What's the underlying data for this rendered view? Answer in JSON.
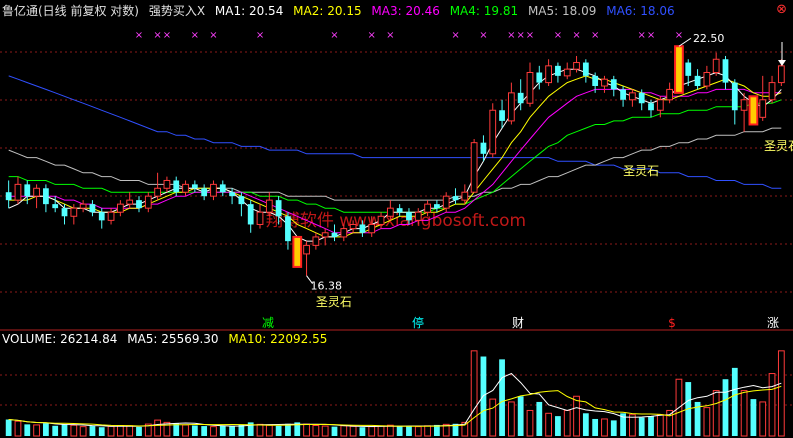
{
  "header": {
    "title": "鲁亿通(日线 前复权 对数)",
    "indicator": "强势买入X",
    "ma": [
      {
        "label": "MA1:",
        "value": "20.54",
        "color": "#ffffff"
      },
      {
        "label": "MA2:",
        "value": "20.15",
        "color": "#ffff00"
      },
      {
        "label": "MA3:",
        "value": "20.46",
        "color": "#ff00ff"
      },
      {
        "label": "MA4:",
        "value": "19.81",
        "color": "#00ff00"
      },
      {
        "label": "MA5:",
        "value": "18.09",
        "color": "#c0c0c0"
      },
      {
        "label": "MA6:",
        "value": "18.06",
        "color": "#3050ff"
      }
    ]
  },
  "volume_header": {
    "items": [
      {
        "label": "VOLUME:",
        "value": "26214.84",
        "color": "#ffffff"
      },
      {
        "label": "MA5:",
        "value": "25569.30",
        "color": "#ffffff"
      },
      {
        "label": "MA10:",
        "value": "22092.55",
        "color": "#ffff00"
      }
    ]
  },
  "watermark": "翔博软件 www.xiangbosoft.com",
  "annotations": {
    "high": "22.50",
    "low": "16.38",
    "stone1": "圣灵石",
    "stone2": "圣灵石",
    "stone3": "圣灵石"
  },
  "signals": [
    {
      "label": "减",
      "color": "#00ff00"
    },
    {
      "label": "停",
      "color": "#00ffff"
    },
    {
      "label": "财",
      "color": "#ffffff"
    },
    {
      "label": "$",
      "color": "#ff2020"
    },
    {
      "label": "涨",
      "color": "#ffffff"
    }
  ],
  "colors": {
    "up": "#ff3a3a",
    "down": "#54ffff",
    "grid": "#8b1a1a",
    "marker": "#ff40ff"
  },
  "chart_data": {
    "type": "candlestick",
    "ylim": [
      15.6,
      23.2
    ],
    "candles": [
      [
        18.4,
        18.2,
        18.7,
        18.0
      ],
      [
        18.2,
        18.6,
        18.8,
        18.1
      ],
      [
        18.6,
        18.3,
        18.7,
        18.1
      ],
      [
        18.3,
        18.5,
        18.6,
        18.0
      ],
      [
        18.5,
        18.1,
        18.6,
        17.9
      ],
      [
        18.1,
        18.0,
        18.3,
        17.9
      ],
      [
        18.0,
        17.8,
        18.1,
        17.6
      ],
      [
        17.8,
        18.0,
        18.1,
        17.6
      ],
      [
        18.0,
        18.1,
        18.2,
        17.9
      ],
      [
        18.1,
        17.9,
        18.2,
        17.8
      ],
      [
        17.9,
        17.7,
        18.0,
        17.5
      ],
      [
        17.7,
        17.9,
        18.0,
        17.6
      ],
      [
        17.9,
        18.1,
        18.2,
        17.8
      ],
      [
        18.1,
        18.2,
        18.4,
        18.0
      ],
      [
        18.2,
        18.0,
        18.3,
        17.9
      ],
      [
        18.0,
        18.3,
        18.4,
        17.9
      ],
      [
        18.3,
        18.5,
        18.9,
        18.2
      ],
      [
        18.5,
        18.7,
        18.8,
        18.4
      ],
      [
        18.7,
        18.4,
        18.8,
        18.3
      ],
      [
        18.4,
        18.6,
        18.7,
        18.3
      ],
      [
        18.6,
        18.5,
        18.7,
        18.4
      ],
      [
        18.5,
        18.3,
        18.6,
        18.2
      ],
      [
        18.3,
        18.6,
        18.7,
        18.2
      ],
      [
        18.6,
        18.4,
        18.7,
        18.3
      ],
      [
        18.4,
        18.3,
        18.5,
        18.1
      ],
      [
        18.3,
        18.1,
        18.4,
        17.8
      ],
      [
        18.1,
        17.6,
        18.2,
        17.4
      ],
      [
        17.6,
        17.9,
        18.1,
        17.5
      ],
      [
        17.9,
        18.2,
        18.4,
        17.8
      ],
      [
        18.2,
        17.8,
        18.3,
        17.6
      ],
      [
        17.8,
        17.2,
        17.9,
        17.0
      ],
      [
        17.2,
        16.9,
        17.3,
        16.6
      ],
      [
        16.9,
        17.1,
        17.2,
        16.4
      ],
      [
        17.1,
        17.3,
        17.4,
        17.0
      ],
      [
        17.3,
        17.4,
        17.5,
        17.1
      ],
      [
        17.4,
        17.3,
        17.6,
        17.2
      ],
      [
        17.3,
        17.5,
        17.6,
        17.2
      ],
      [
        17.5,
        17.6,
        17.7,
        17.4
      ],
      [
        17.6,
        17.4,
        17.7,
        17.3
      ],
      [
        17.4,
        17.6,
        17.8,
        17.3
      ],
      [
        17.6,
        17.8,
        17.9,
        17.5
      ],
      [
        17.8,
        18.0,
        18.2,
        17.7
      ],
      [
        18.0,
        17.9,
        18.1,
        17.8
      ],
      [
        17.9,
        17.7,
        18.0,
        17.6
      ],
      [
        17.7,
        17.9,
        18.0,
        17.6
      ],
      [
        17.9,
        18.1,
        18.2,
        17.8
      ],
      [
        18.1,
        18.0,
        18.2,
        17.9
      ],
      [
        18.0,
        18.3,
        18.4,
        17.9
      ],
      [
        18.3,
        18.2,
        18.5,
        18.1
      ],
      [
        18.2,
        18.4,
        18.6,
        18.1
      ],
      [
        18.4,
        19.7,
        19.8,
        18.4
      ],
      [
        19.7,
        19.4,
        19.9,
        19.2
      ],
      [
        19.4,
        20.6,
        20.8,
        19.3
      ],
      [
        20.6,
        20.3,
        20.9,
        20.1
      ],
      [
        20.3,
        21.1,
        21.4,
        20.2
      ],
      [
        21.1,
        20.8,
        21.5,
        20.6
      ],
      [
        20.8,
        21.7,
        22.0,
        20.7
      ],
      [
        21.7,
        21.4,
        21.9,
        21.2
      ],
      [
        21.4,
        21.9,
        22.1,
        21.3
      ],
      [
        21.9,
        21.6,
        22.0,
        21.4
      ],
      [
        21.6,
        21.8,
        22.0,
        21.5
      ],
      [
        21.8,
        22.0,
        22.2,
        21.7
      ],
      [
        22.0,
        21.6,
        22.1,
        21.4
      ],
      [
        21.6,
        21.3,
        21.7,
        21.1
      ],
      [
        21.3,
        21.5,
        21.6,
        21.1
      ],
      [
        21.5,
        21.2,
        21.6,
        21.0
      ],
      [
        21.2,
        20.9,
        21.3,
        20.7
      ],
      [
        20.9,
        21.1,
        21.2,
        20.7
      ],
      [
        21.1,
        20.8,
        21.2,
        20.6
      ],
      [
        20.8,
        20.6,
        20.9,
        20.4
      ],
      [
        20.6,
        20.9,
        21.0,
        20.4
      ],
      [
        20.9,
        21.2,
        21.4,
        20.8
      ],
      [
        21.2,
        22.0,
        22.5,
        21.1
      ],
      [
        22.0,
        21.6,
        22.1,
        21.3
      ],
      [
        21.6,
        21.3,
        21.8,
        21.2
      ],
      [
        21.3,
        21.7,
        21.9,
        21.2
      ],
      [
        21.7,
        22.1,
        22.3,
        21.6
      ],
      [
        22.1,
        21.4,
        22.2,
        21.2
      ],
      [
        21.4,
        20.6,
        21.5,
        20.2
      ],
      [
        20.6,
        20.9,
        21.1,
        20.0
      ],
      [
        20.9,
        20.4,
        21.0,
        20.2
      ],
      [
        20.4,
        20.9,
        21.6,
        20.3
      ],
      [
        20.9,
        21.4,
        21.6,
        20.8
      ],
      [
        21.4,
        21.9,
        22.1,
        21.3
      ]
    ],
    "volumes": [
      5800,
      5200,
      4100,
      3900,
      4500,
      3600,
      4200,
      3800,
      3300,
      3500,
      3100,
      3400,
      3700,
      3600,
      3200,
      4200,
      5600,
      4800,
      4400,
      3900,
      3700,
      3500,
      3300,
      3600,
      3400,
      3900,
      4800,
      4100,
      3800,
      3600,
      4300,
      4800,
      4200,
      3700,
      3500,
      3300,
      3600,
      3400,
      3100,
      3300,
      3500,
      3800,
      3600,
      3400,
      3300,
      3600,
      3900,
      4100,
      4300,
      4800,
      30000,
      28000,
      13000,
      27000,
      12000,
      14000,
      9000,
      12000,
      8000,
      7000,
      9000,
      14000,
      8000,
      6000,
      6000,
      5500,
      8000,
      7500,
      6500,
      7000,
      7500,
      9000,
      20000,
      19000,
      12000,
      10000,
      16000,
      20000,
      24000,
      16000,
      13000,
      12000,
      22000,
      30000
    ],
    "ma1": [
      18.0,
      18.1,
      18.3,
      18.3,
      18.3,
      18.2,
      18.0,
      18.0,
      18.0,
      17.9,
      17.9,
      17.9,
      18.0,
      18.1,
      18.1,
      18.2,
      18.3,
      18.4,
      18.5,
      18.5,
      18.5,
      18.4,
      18.5,
      18.5,
      18.4,
      18.2,
      18.0,
      17.9,
      17.9,
      17.8,
      17.6,
      17.3,
      17.2,
      17.2,
      17.3,
      17.3,
      17.4,
      17.5,
      17.5,
      17.6,
      17.7,
      17.9,
      17.9,
      17.9,
      17.9,
      18.0,
      18.0,
      18.1,
      18.2,
      18.3,
      18.8,
      19.2,
      19.7,
      20.1,
      20.5,
      20.8,
      21.1,
      21.4,
      21.6,
      21.7,
      21.8,
      21.8,
      21.7,
      21.6,
      21.4,
      21.3,
      21.1,
      21.0,
      20.9,
      20.8,
      20.9,
      21.0,
      21.3,
      21.4,
      21.5,
      21.6,
      21.7,
      21.6,
      21.3,
      21.0,
      20.8,
      20.7,
      20.9,
      21.2
    ],
    "ma2": [
      18.2,
      18.2,
      18.2,
      18.3,
      18.3,
      18.2,
      18.1,
      18.0,
      18.0,
      18.0,
      17.9,
      17.9,
      17.9,
      18.0,
      18.0,
      18.1,
      18.2,
      18.3,
      18.4,
      18.4,
      18.5,
      18.5,
      18.5,
      18.5,
      18.4,
      18.3,
      18.2,
      18.1,
      18.0,
      17.9,
      17.8,
      17.6,
      17.5,
      17.4,
      17.3,
      17.3,
      17.3,
      17.4,
      17.4,
      17.5,
      17.6,
      17.7,
      17.8,
      17.8,
      17.8,
      17.9,
      17.9,
      18.0,
      18.1,
      18.1,
      18.4,
      18.7,
      19.0,
      19.3,
      19.7,
      20.0,
      20.4,
      20.7,
      21.0,
      21.2,
      21.4,
      21.5,
      21.6,
      21.5,
      21.5,
      21.4,
      21.3,
      21.2,
      21.1,
      21.0,
      20.9,
      20.9,
      21.0,
      21.1,
      21.2,
      21.3,
      21.4,
      21.5,
      21.4,
      21.3,
      21.1,
      21.0,
      21.0,
      21.1
    ],
    "ma3": [
      18.3,
      18.3,
      18.3,
      18.3,
      18.3,
      18.3,
      18.2,
      18.2,
      18.1,
      18.1,
      18.0,
      18.0,
      18.0,
      18.0,
      18.0,
      18.1,
      18.1,
      18.2,
      18.3,
      18.3,
      18.4,
      18.4,
      18.4,
      18.4,
      18.4,
      18.4,
      18.3,
      18.2,
      18.1,
      18.0,
      17.9,
      17.8,
      17.7,
      17.6,
      17.5,
      17.4,
      17.4,
      17.4,
      17.4,
      17.4,
      17.5,
      17.5,
      17.6,
      17.6,
      17.7,
      17.7,
      17.8,
      17.9,
      17.9,
      18.0,
      18.2,
      18.4,
      18.6,
      18.9,
      19.2,
      19.5,
      19.8,
      20.1,
      20.4,
      20.6,
      20.8,
      21.0,
      21.1,
      21.2,
      21.2,
      21.2,
      21.2,
      21.2,
      21.1,
      21.1,
      21.0,
      21.0,
      21.0,
      21.0,
      21.1,
      21.1,
      21.2,
      21.2,
      21.2,
      21.2,
      21.1,
      21.1,
      21.1,
      21.1
    ],
    "ma4": [
      18.8,
      18.8,
      18.7,
      18.7,
      18.7,
      18.6,
      18.6,
      18.6,
      18.5,
      18.5,
      18.5,
      18.4,
      18.4,
      18.4,
      18.4,
      18.4,
      18.4,
      18.4,
      18.4,
      18.4,
      18.4,
      18.4,
      18.4,
      18.4,
      18.4,
      18.4,
      18.4,
      18.3,
      18.3,
      18.3,
      18.2,
      18.2,
      18.1,
      18.1,
      18.0,
      18.0,
      17.9,
      17.9,
      17.9,
      17.9,
      17.9,
      17.9,
      17.9,
      17.9,
      17.9,
      17.9,
      18.0,
      18.0,
      18.1,
      18.1,
      18.2,
      18.3,
      18.4,
      18.6,
      18.8,
      19.0,
      19.2,
      19.4,
      19.6,
      19.7,
      19.9,
      20.0,
      20.1,
      20.2,
      20.2,
      20.3,
      20.3,
      20.4,
      20.4,
      20.4,
      20.5,
      20.5,
      20.5,
      20.6,
      20.6,
      20.6,
      20.7,
      20.7,
      20.7,
      20.7,
      20.8,
      20.8,
      20.8,
      20.9
    ],
    "ma5": [
      19.5,
      19.4,
      19.3,
      19.3,
      19.2,
      19.1,
      19.1,
      19.0,
      18.9,
      18.9,
      18.8,
      18.8,
      18.7,
      18.7,
      18.7,
      18.6,
      18.6,
      18.6,
      18.6,
      18.5,
      18.5,
      18.5,
      18.5,
      18.5,
      18.5,
      18.4,
      18.4,
      18.4,
      18.4,
      18.4,
      18.3,
      18.3,
      18.3,
      18.3,
      18.3,
      18.2,
      18.2,
      18.2,
      18.2,
      18.2,
      18.2,
      18.2,
      18.2,
      18.2,
      18.2,
      18.2,
      18.2,
      18.2,
      18.3,
      18.3,
      18.3,
      18.4,
      18.4,
      18.5,
      18.5,
      18.6,
      18.6,
      18.7,
      18.8,
      18.8,
      18.9,
      19.0,
      19.1,
      19.1,
      19.2,
      19.3,
      19.3,
      19.4,
      19.5,
      19.5,
      19.6,
      19.6,
      19.7,
      19.7,
      19.8,
      19.8,
      19.9,
      19.9,
      19.9,
      20.0,
      20.0,
      20.0,
      20.1,
      20.1
    ],
    "ma6": [
      21.6,
      21.5,
      21.4,
      21.3,
      21.2,
      21.1,
      21.0,
      20.9,
      20.8,
      20.7,
      20.6,
      20.5,
      20.4,
      20.3,
      20.2,
      20.1,
      20.0,
      20.0,
      19.9,
      19.9,
      19.8,
      19.8,
      19.7,
      19.7,
      19.7,
      19.6,
      19.6,
      19.6,
      19.5,
      19.5,
      19.5,
      19.5,
      19.4,
      19.4,
      19.4,
      19.4,
      19.4,
      19.4,
      19.3,
      19.3,
      19.3,
      19.3,
      19.3,
      19.3,
      19.3,
      19.3,
      19.3,
      19.3,
      19.3,
      19.3,
      19.3,
      19.3,
      19.3,
      19.3,
      19.3,
      19.3,
      19.3,
      19.3,
      19.3,
      19.2,
      19.2,
      19.2,
      19.2,
      19.1,
      19.1,
      19.1,
      19.0,
      19.0,
      19.0,
      19.0,
      18.9,
      18.9,
      18.9,
      18.8,
      18.8,
      18.8,
      18.7,
      18.7,
      18.7,
      18.6,
      18.6,
      18.6,
      18.5,
      18.5
    ]
  }
}
